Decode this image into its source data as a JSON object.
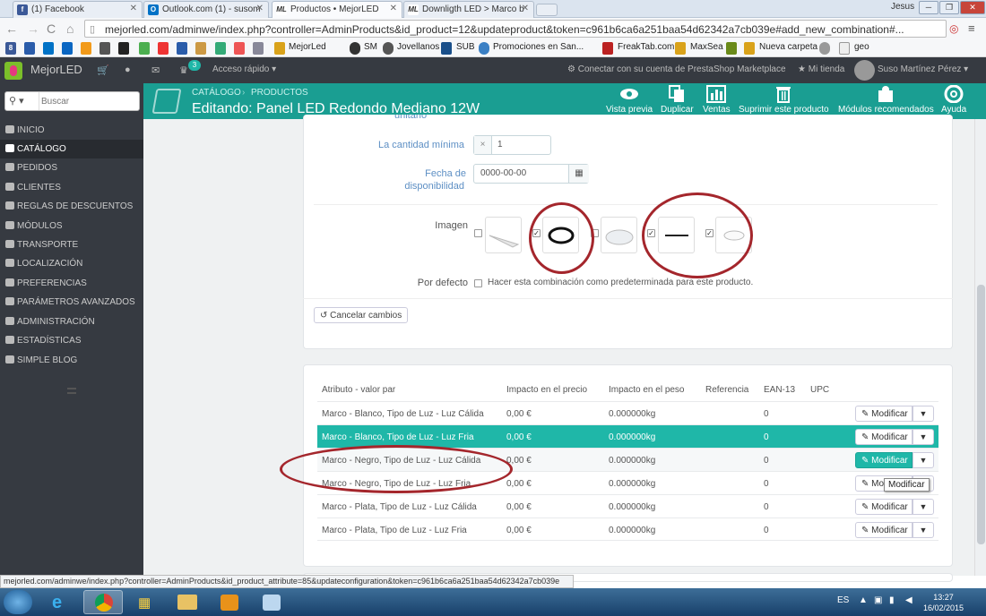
{
  "browser": {
    "tabs": [
      {
        "title": "(1) Facebook",
        "icon": "facebook-icon",
        "color": "#3b5998"
      },
      {
        "title": "Outlook.com (1) - susom",
        "icon": "outlook-icon",
        "color": "#0072c6"
      },
      {
        "title": "Productos • MejorLED",
        "icon": "mejorled-icon",
        "color": "#333333"
      },
      {
        "title": "Downligth LED > Marco b",
        "icon": "mejorled-icon",
        "color": "#333333"
      }
    ],
    "window_user": "Jesus",
    "url": "mejorled.com/adminwe/index.php?controller=AdminProducts&id_product=12&updateproduct&token=c961b6ca6a251baa54d62342a7cb039e#add_new_combination#...",
    "bookmarks": [
      "MejorLed",
      "SM",
      "Jovellanos",
      "SUB",
      "Promociones en San...",
      "FreakTab.com",
      "MaxSea",
      "Nueva carpeta",
      "geo"
    ],
    "status_url": "mejorled.com/adminwe/index.php?controller=AdminProducts&id_product_attribute=85&updateconfiguration&token=c961b6ca6a251baa54d62342a7cb039e"
  },
  "admin": {
    "brand": "MejorLED",
    "notif_count": "3",
    "quick_access": "Acceso rápido",
    "marketplace": "Conectar con su cuenta de PrestaShop Marketplace",
    "shop": "Mi tienda",
    "user": "Suso Martínez Pérez",
    "search_placeholder": "Buscar"
  },
  "sidebar": [
    {
      "label": "INICIO",
      "icon": "home-icon"
    },
    {
      "label": "CATÁLOGO",
      "icon": "catalog-icon",
      "active": true
    },
    {
      "label": "PEDIDOS",
      "icon": "orders-icon"
    },
    {
      "label": "CLIENTES",
      "icon": "customers-icon"
    },
    {
      "label": "REGLAS DE DESCUENTOS",
      "icon": "discount-icon"
    },
    {
      "label": "MÓDULOS",
      "icon": "modules-icon"
    },
    {
      "label": "TRANSPORTE",
      "icon": "truck-icon"
    },
    {
      "label": "LOCALIZACIÓN",
      "icon": "globe-icon"
    },
    {
      "label": "PREFERENCIAS",
      "icon": "wrench-icon"
    },
    {
      "label": "PARÁMETROS AVANZADOS",
      "icon": "cogs-icon"
    },
    {
      "label": "ADMINISTRACIÓN",
      "icon": "gear-icon"
    },
    {
      "label": "ESTADÍSTICAS",
      "icon": "stats-icon"
    },
    {
      "label": "SIMPLE BLOG",
      "icon": "blog-icon"
    }
  ],
  "header": {
    "breadcrumb": [
      "CATÁLOGO",
      "PRODUCTOS"
    ],
    "title": "Editando: Panel LED Redondo Mediano 12W",
    "toolbar": [
      {
        "label": "Vista previa",
        "icon": "eye-icon"
      },
      {
        "label": "Duplicar",
        "icon": "duplicate-icon"
      },
      {
        "label": "Ventas",
        "icon": "bar-chart-icon"
      },
      {
        "label": "Suprimir este producto",
        "icon": "trash-icon"
      },
      {
        "label": "Módulos recomendados",
        "icon": "puzzle-icon"
      },
      {
        "label": "Ayuda",
        "icon": "lifebuoy-icon"
      }
    ]
  },
  "form": {
    "cut_label": "unitario",
    "min_qty_label": "La cantidad mínima",
    "min_qty_prefix": "×",
    "min_qty_value": "1",
    "date_label_1": "Fecha de",
    "date_label_2": "disponibilidad",
    "date_value": "0000-00-00",
    "image_label": "Imagen",
    "images": [
      {
        "name": "panel-side",
        "checked": false
      },
      {
        "name": "black-ring",
        "checked": true
      },
      {
        "name": "white-panel",
        "checked": false
      },
      {
        "name": "flat-line",
        "checked": true
      },
      {
        "name": "mounted-panel",
        "checked": true
      }
    ],
    "default_label": "Por defecto",
    "default_text": "Hacer esta combinación como predeterminada para este producto.",
    "cancel_label": "Cancelar cambios"
  },
  "table": {
    "headers": [
      "Atributo - valor par",
      "Impacto en el precio",
      "Impacto en el peso",
      "Referencia",
      "EAN-13",
      "UPC"
    ],
    "rows": [
      {
        "attr": "Marco - Blanco, Tipo de Luz - Luz Cálida",
        "price": "0,00 €",
        "weight": "0.000000kg",
        "ean": "0",
        "action": "Modificar"
      },
      {
        "attr": "Marco - Blanco, Tipo de Luz - Luz Fria",
        "price": "0,00 €",
        "weight": "0.000000kg",
        "ean": "0",
        "action": "Modificar",
        "selected": true
      },
      {
        "attr": "Marco - Negro, Tipo de Luz - Luz Cálida",
        "price": "0,00 €",
        "weight": "0.000000kg",
        "ean": "0",
        "action": "Modificar",
        "hover": true
      },
      {
        "attr": "Marco - Negro, Tipo de Luz - Luz Fria",
        "price": "0,00 €",
        "weight": "0.000000kg",
        "ean": "0",
        "action": "Mo"
      },
      {
        "attr": "Marco - Plata, Tipo de Luz - Luz Cálida",
        "price": "0,00 €",
        "weight": "0.000000kg",
        "ean": "0",
        "action": "Modificar"
      },
      {
        "attr": "Marco - Plata, Tipo de Luz - Luz Fria",
        "price": "0,00 €",
        "weight": "0.000000kg",
        "ean": "0",
        "action": "Modificar"
      }
    ],
    "tooltip": "Modificar"
  },
  "taskbar": {
    "lang": "ES",
    "time": "13:27",
    "date": "16/02/2015"
  },
  "colors": {
    "accent": "#1fb7a8",
    "header": "#1a9e92",
    "dark": "#363a41",
    "link": "#5d8fc4",
    "annotation": "#a4262c"
  }
}
